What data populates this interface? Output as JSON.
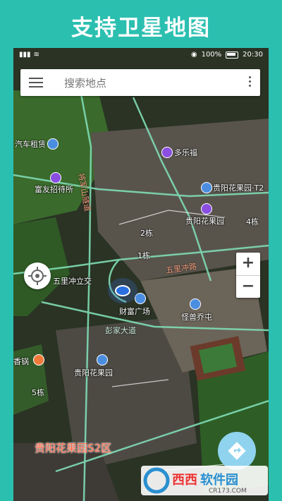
{
  "promo_title": "支持卫星地图",
  "statusbar": {
    "battery": "100%",
    "time": "20:30"
  },
  "search": {
    "placeholder": "搜索地点"
  },
  "pois": {
    "car_rental": "汽车租赁",
    "duolefu": "多乐福",
    "fuyou_inn": "富友招待所",
    "guiyang_garden_t2": "贵阳花果园·T2",
    "guiyang_garden": "贵阳花果园",
    "wulichong_interchange": "五里冲立交",
    "caifu_plaza": "财富广场",
    "guaishou_town": "怪兽乔屯",
    "guiyang_garden_2": "贵阳花果园",
    "hotpot": "香锅",
    "building_5": "5栋",
    "building_2": "2栋",
    "building_4": "4栋",
    "building_1": "1栋"
  },
  "roads": {
    "tuanpo": "将军山隧道",
    "wulichong_road": "五里冲路",
    "pengjia_road": "彭家大道"
  },
  "district_label": "贵阳花果园S2区",
  "zoom": {
    "in": "+",
    "out": "−"
  },
  "watermark": {
    "brand": "西西软件园",
    "url": "CR173.COM"
  },
  "colors": {
    "frame": "#2bbfb0",
    "road": "#7fdcb4",
    "district": "#ff6a4a"
  }
}
